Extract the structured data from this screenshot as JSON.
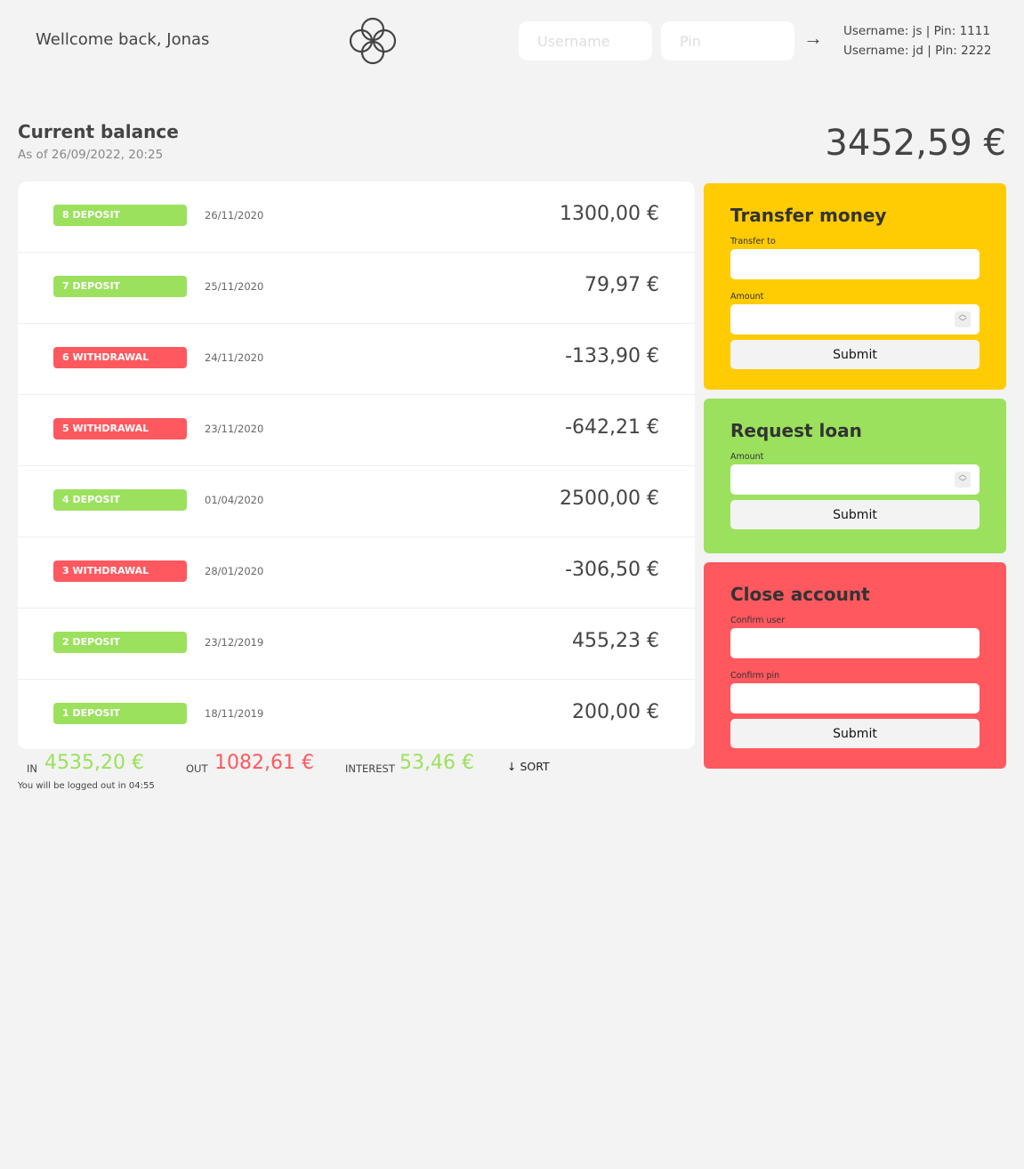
{
  "header": {
    "welcome": "Wellcome back, Jonas",
    "username_placeholder": "Username",
    "pin_placeholder": "Pin",
    "login_arrow": "→",
    "hints": [
      "Username: js | Pin: 1111",
      "Username: jd | Pin: 2222"
    ]
  },
  "balance": {
    "title": "Current balance",
    "date": "As of 26/09/2022, 20:25",
    "value": "3452,59 €"
  },
  "movements": [
    {
      "type": "deposit",
      "label": "8 DEPOSIT",
      "date": "26/11/2020",
      "value": "1300,00 €"
    },
    {
      "type": "deposit",
      "label": "7 DEPOSIT",
      "date": "25/11/2020",
      "value": "79,97 €"
    },
    {
      "type": "withdrawal",
      "label": "6 WITHDRAWAL",
      "date": "24/11/2020",
      "value": "-133,90 €"
    },
    {
      "type": "withdrawal",
      "label": "5 WITHDRAWAL",
      "date": "23/11/2020",
      "value": "-642,21 €"
    },
    {
      "type": "deposit",
      "label": "4 DEPOSIT",
      "date": "01/04/2020",
      "value": "2500,00 €"
    },
    {
      "type": "withdrawal",
      "label": "3 WITHDRAWAL",
      "date": "28/01/2020",
      "value": "-306,50 €"
    },
    {
      "type": "deposit",
      "label": "2 DEPOSIT",
      "date": "23/12/2019",
      "value": "455,23 €"
    },
    {
      "type": "deposit",
      "label": "1 DEPOSIT",
      "date": "18/11/2019",
      "value": "200,00 €"
    }
  ],
  "summary": {
    "in_label": "IN",
    "in_value": "4535,20 €",
    "out_label": "OUT",
    "out_value": "1082,61 €",
    "interest_label": "INTEREST",
    "interest_value": "53,46 €",
    "sort_label": "↓ SORT",
    "logout_timer": "You will be logged out in 04:55"
  },
  "transfer": {
    "title": "Transfer money",
    "to_label": "Transfer to",
    "amount_label": "Amount",
    "submit": "Submit"
  },
  "loan": {
    "title": "Request loan",
    "amount_label": "Amount",
    "submit": "Submit"
  },
  "close": {
    "title": "Close account",
    "user_label": "Confirm user",
    "pin_label": "Confirm pin",
    "submit": "Submit"
  },
  "colors": {
    "background": "#f3f3f3",
    "deposit": "#9be15d",
    "withdrawal": "#ff585f",
    "transfer": "#ffcb03"
  }
}
